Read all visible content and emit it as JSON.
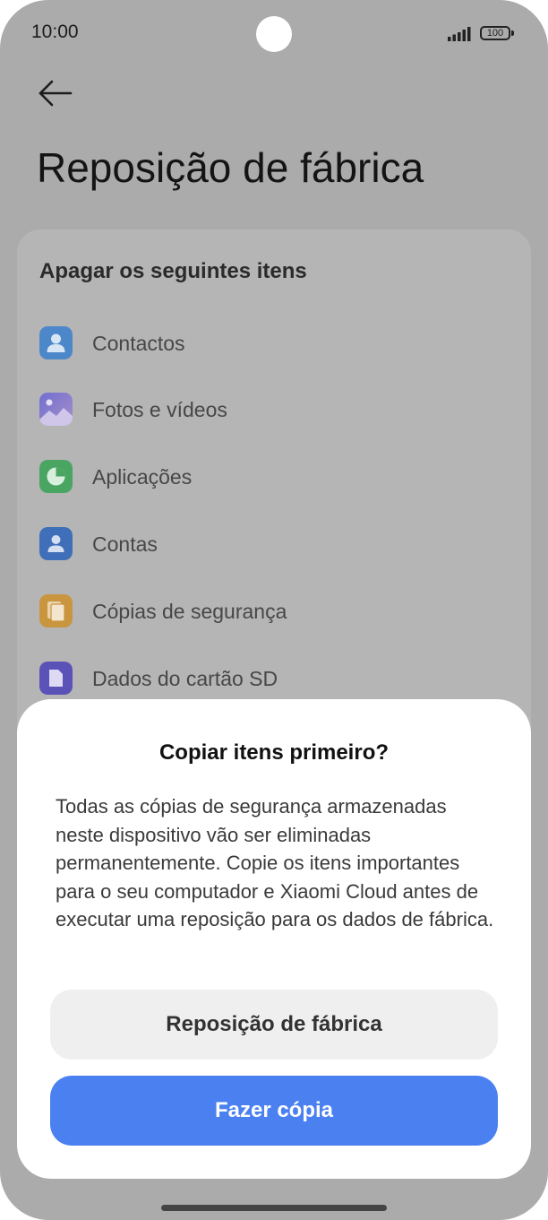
{
  "status": {
    "time": "10:00",
    "battery": "100"
  },
  "page": {
    "title": "Reposição de fábrica"
  },
  "card": {
    "title": "Apagar os seguintes itens",
    "items": [
      {
        "label": "Contactos",
        "icon": "contacts-icon"
      },
      {
        "label": "Fotos e vídeos",
        "icon": "gallery-icon"
      },
      {
        "label": "Aplicações",
        "icon": "apps-icon"
      },
      {
        "label": "Contas",
        "icon": "accounts-icon"
      },
      {
        "label": "Cópias de segurança",
        "icon": "backup-icon"
      },
      {
        "label": "Dados do cartão SD",
        "icon": "sd-card-icon"
      }
    ]
  },
  "dialog": {
    "title": "Copiar itens primeiro?",
    "body": "Todas as cópias de segurança armazenadas neste dispositivo vão ser eliminadas permanentemente. Copie os itens importantes para o seu computador e Xiaomi Cloud antes de executar uma reposição para os dados de fábrica.",
    "reset_label": "Reposição de fábrica",
    "copy_label": "Fazer cópia"
  },
  "colors": {
    "primary": "#4a80f0",
    "scrim": "#ababab",
    "sheet": "#ffffff"
  }
}
